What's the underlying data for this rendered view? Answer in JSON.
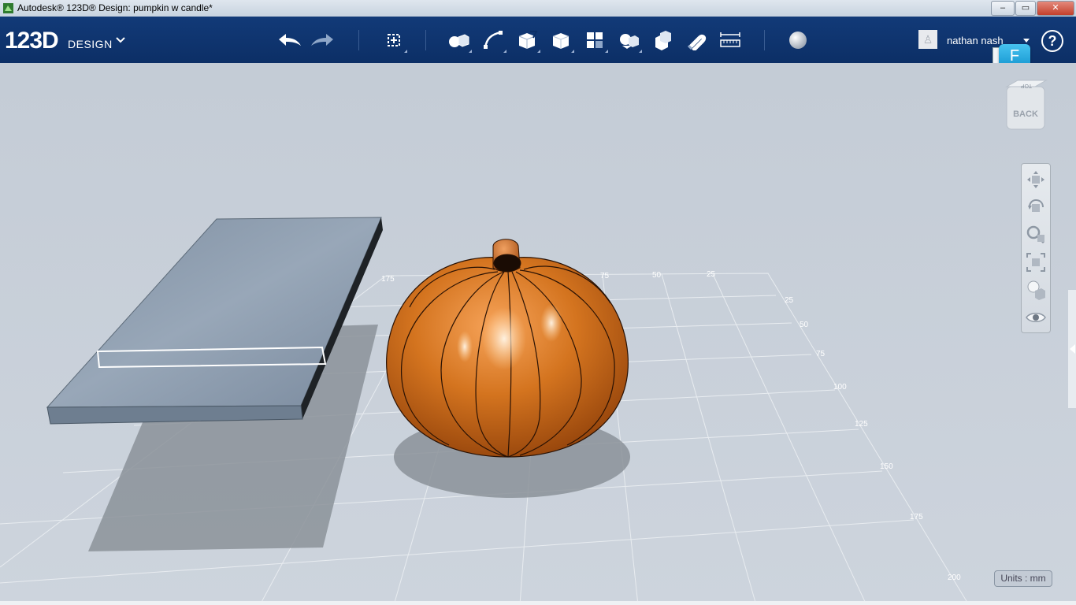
{
  "window": {
    "title": "Autodesk® 123D® Design: pumpkin w candle*",
    "minimize": "–",
    "maximize": "▭",
    "close": "✕"
  },
  "app": {
    "logo_number": "123D",
    "logo_text": "DESIGN"
  },
  "toolbar": {
    "tools": [
      "undo-icon",
      "redo-icon",
      "transform-icon",
      "primitives-icon",
      "sketch-icon",
      "construct-icon",
      "modify-icon",
      "pattern-icon",
      "grouping-icon",
      "combine-icon",
      "snap-icon",
      "measure-icon",
      "material-icon"
    ]
  },
  "user": {
    "name": "nathan nash",
    "help": "?",
    "badge": "F"
  },
  "viewcube": {
    "top_label": "TOP",
    "face_label": "BACK"
  },
  "navigation": {
    "tools": [
      "pan-icon",
      "orbit-icon",
      "zoom-icon",
      "fit-icon",
      "view-style-icon",
      "visibility-icon"
    ]
  },
  "grid": {
    "labels_top": [
      "175",
      "75",
      "50",
      "25"
    ],
    "labels_right": [
      "25",
      "50",
      "75",
      "100",
      "125",
      "150",
      "175",
      "200"
    ]
  },
  "status": {
    "units": "Units : mm"
  },
  "scene": {
    "objects": [
      "slab",
      "pumpkin"
    ]
  },
  "colors": {
    "toolbar_bg": "#0c2f66",
    "viewport_bg": "#c9d1da",
    "pumpkin": "#c0621a",
    "slab_top": "#8b9aab",
    "accent": "#1ea3e0"
  }
}
